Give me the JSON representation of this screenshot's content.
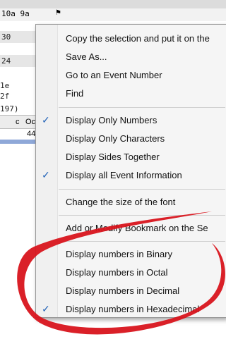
{
  "hex_background": {
    "top_row": "10a 9a",
    "rows": [
      "30",
      "24",
      "1e",
      "2f",
      "197)"
    ],
    "col_header": "Oc",
    "col_c": "c",
    "cell_value": "44"
  },
  "menu": {
    "items": [
      {
        "label": "Copy the selection and put it on the",
        "checked": false
      },
      {
        "label": "Save As...",
        "checked": false
      },
      {
        "label": "Go to an Event Number",
        "checked": false
      },
      {
        "label": "Find",
        "checked": false
      },
      {
        "label": "Display Only Numbers",
        "checked": true
      },
      {
        "label": "Display Only Characters",
        "checked": false
      },
      {
        "label": "Display Sides Together",
        "checked": false
      },
      {
        "label": "Display all Event Information",
        "checked": true
      },
      {
        "label": "Change the size of the font",
        "checked": false
      },
      {
        "label": "Add or Modify Bookmark on the Se",
        "checked": false
      },
      {
        "label": "Display numbers in Binary",
        "checked": false
      },
      {
        "label": "Display numbers in Octal",
        "checked": false
      },
      {
        "label": "Display numbers in Decimal",
        "checked": false
      },
      {
        "label": "Display numbers in Hexadecimal",
        "checked": true
      }
    ],
    "check_glyph": "✓"
  },
  "colors": {
    "annotation": "#d8141c",
    "check": "#2464b8"
  }
}
